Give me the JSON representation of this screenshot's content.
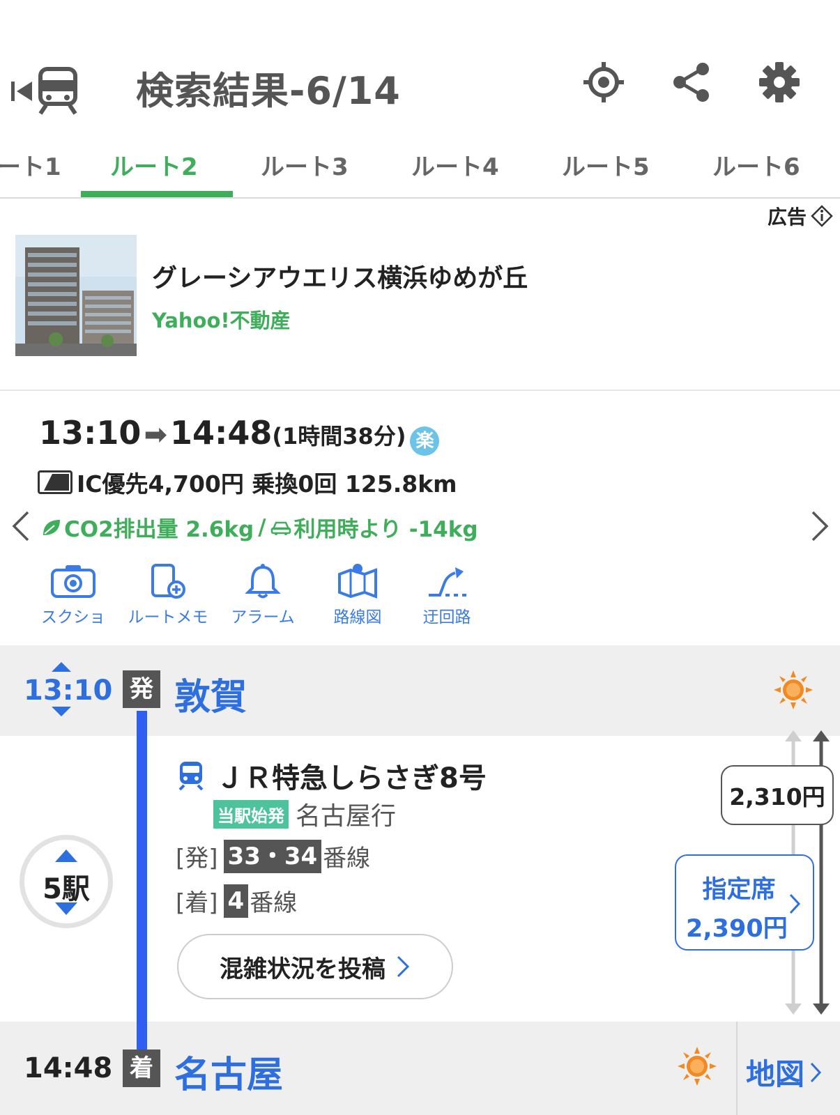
{
  "header": {
    "title": "検索結果-6/14"
  },
  "tabs": [
    {
      "label": "ート1"
    },
    {
      "label": "ルート2"
    },
    {
      "label": "ルート3"
    },
    {
      "label": "ルート4"
    },
    {
      "label": "ルート5"
    },
    {
      "label": "ルート6"
    }
  ],
  "ad": {
    "label": "広告",
    "title": "グレーシアウエリス横浜ゆめが丘",
    "sponsor": "Yahoo!不動産"
  },
  "summary": {
    "dep_time": "13:10",
    "arrow": "➡",
    "arr_time": "14:48",
    "duration": "(1時間38分)",
    "raku_badge": "楽",
    "fare_text": "IC優先4,700円 乗換0回 125.8km",
    "co2_text": "CO2排出量 2.6kg",
    "slash": "/",
    "car_text": "利用時より -14kg"
  },
  "tools": [
    {
      "label": "スクショ",
      "icon": "camera-icon"
    },
    {
      "label": "ルートメモ",
      "icon": "memo-add-icon"
    },
    {
      "label": "アラーム",
      "icon": "bell-icon"
    },
    {
      "label": "路線図",
      "icon": "route-map-icon"
    },
    {
      "label": "迂回路",
      "icon": "detour-icon"
    }
  ],
  "route": {
    "departure": {
      "time": "13:10",
      "badge": "発",
      "station": "敦賀"
    },
    "arrival": {
      "time": "14:48",
      "badge": "着",
      "station": "名古屋"
    },
    "train": {
      "name": "ＪＲ特急しらさぎ8号",
      "start_tag": "当駅始発",
      "destination": "名古屋行",
      "dep_label": "[発]",
      "dep_platform": "33・34",
      "arr_label": "[着]",
      "arr_platform": "4",
      "platform_suffix": "番線"
    },
    "stops": "5駅",
    "congestion_button": "混雑状況を投稿",
    "fare": "2,310円",
    "reserved": {
      "label": "指定席",
      "price": "2,390円"
    },
    "map_button": "地図"
  },
  "colors": {
    "accent_green": "#3fae5a",
    "link_blue": "#2e6fe0",
    "route_line": "#2e5ff0",
    "weather_orange": "#f08a24"
  }
}
